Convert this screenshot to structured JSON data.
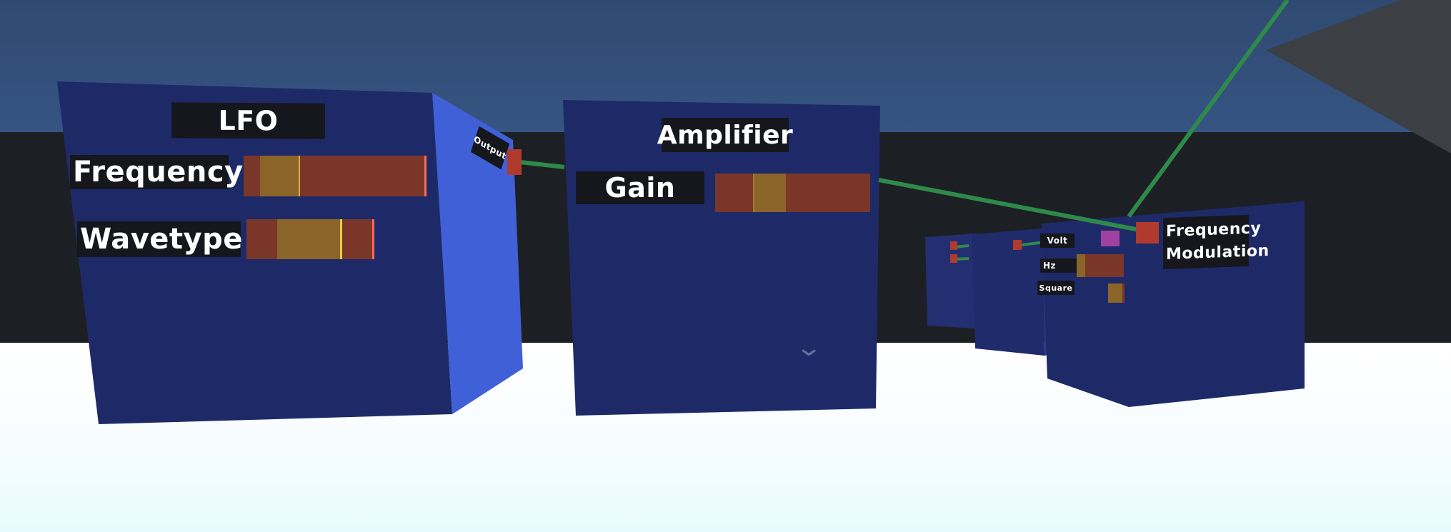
{
  "colors": {
    "sky": "#34527e",
    "backdrop": "#1c1f24",
    "floor": "#ffffff",
    "panel_front": "#1e2a68",
    "panel_side": "#4060d8",
    "label_bg": "#15171d",
    "slider_track": "#7a3628",
    "slider_knob": "#8a6428",
    "slider_edge": "#ff6a55",
    "cable": "#2e8a4a",
    "port": "#b03a2e",
    "magenta_port": "#a040a0",
    "far_object": "#3c3f44"
  },
  "icons": {
    "collapse": "chevron-down-icon",
    "far_object": "gray-cone-shape"
  },
  "lfo": {
    "title": "LFO",
    "frequency": {
      "label": "Frequency",
      "value": 0.2
    },
    "wavetype": {
      "label": "Wavetype",
      "value": 0.5
    },
    "output_label": "Output"
  },
  "amplifier": {
    "title": "Amplifier",
    "gain": {
      "label": "Gain",
      "value": 0.35
    },
    "collapse_glyph": "⌄"
  },
  "oscillator": {
    "modulation_label": "Frequency\nModulation",
    "tiny_labels": [
      "Volt",
      "Hz",
      "Square"
    ]
  }
}
